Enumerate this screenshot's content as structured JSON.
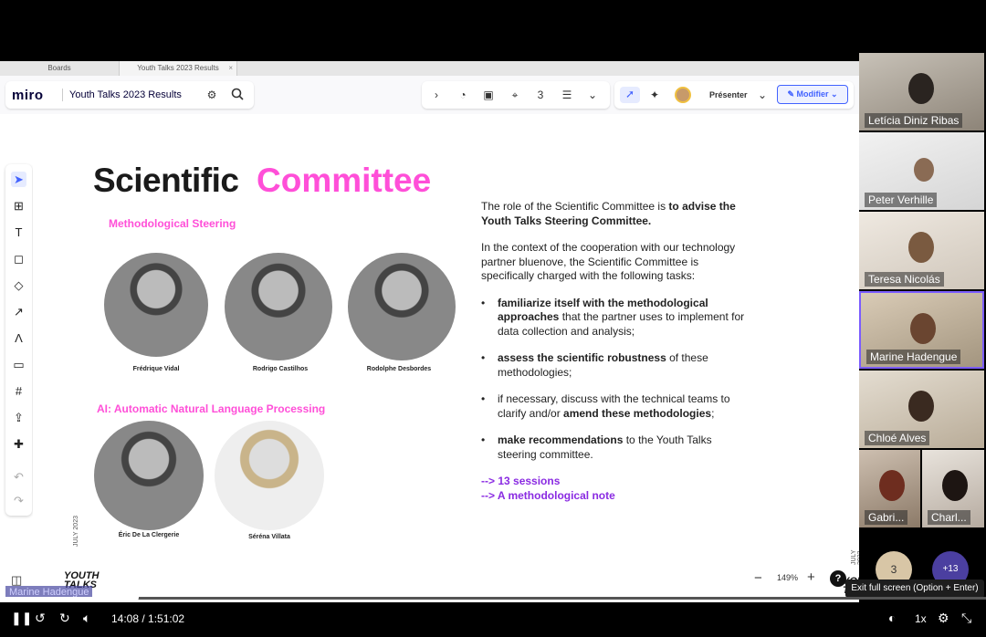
{
  "browser": {
    "tabs": [
      {
        "label": "Boards"
      },
      {
        "label": "Youth Talks 2023 Results"
      }
    ]
  },
  "miro": {
    "logo": "miro",
    "board_name": "Youth Talks 2023 Results",
    "presenter_label": "Présenter",
    "modify_label": "Modifier",
    "zoom": "149%"
  },
  "slide": {
    "title_black": "Scientific",
    "title_pink": "Committee",
    "section1": "Methodological Steering",
    "section2": "AI: Automatic Natural Language Processing",
    "people": [
      {
        "name": "Frédrique Vidal"
      },
      {
        "name": "Rodrigo Castilhos"
      },
      {
        "name": "Rodolphe Desbordes"
      },
      {
        "name": "Éric De La Clergerie"
      },
      {
        "name": "Séréna Villata"
      }
    ],
    "intro_plain": "The role of the Scientific Committee is ",
    "intro_bold": "to advise the Youth Talks Steering Committee.",
    "context": "In the context of the cooperation with our technology partner bluenove, the Scientific Committee is specifically charged with the following tasks:",
    "bullets": [
      {
        "bold": "familiarize itself with the methodological approaches",
        "rest": " that the partner uses to implement for data collection and analysis;"
      },
      {
        "bold": "assess the scientific robustness",
        "rest": " of these methodologies;"
      },
      {
        "pre": "if necessary, discuss with the technical teams to clarify and/or ",
        "bold": "amend these methodologies",
        "rest": ";"
      },
      {
        "bold": "make recommendations",
        "rest": " to the Youth Talks steering committee."
      }
    ],
    "link1": "--> 13 sessions",
    "link2": "--> A methodological note",
    "side_date": "JULY 2023",
    "brand": "YOUTH TALKS"
  },
  "participants": [
    {
      "name": "Letícia Diniz Ribas"
    },
    {
      "name": "Peter Verhille"
    },
    {
      "name": "Teresa Nicolás"
    },
    {
      "name": "Marine Hadengue"
    },
    {
      "name": "Chloé Alves"
    },
    {
      "name": "Gabri..."
    },
    {
      "name": "Charl..."
    }
  ],
  "participant_extra": {
    "count_badge": "3",
    "more": "+13"
  },
  "speaker_label": "Marine Hadengue",
  "player": {
    "time": "14:08 / 1:51:02",
    "speed": "1x",
    "tooltip": "Exit full screen (Option + Enter)",
    "progress_fraction": 0.135
  }
}
